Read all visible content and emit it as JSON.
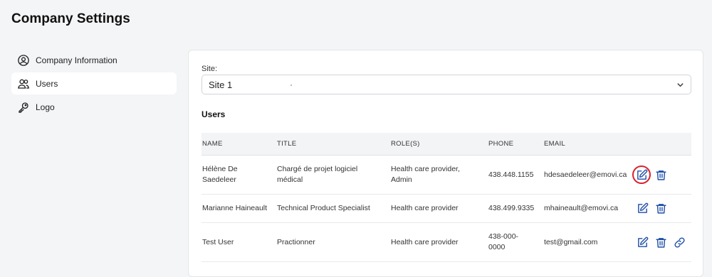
{
  "page": {
    "title": "Company Settings"
  },
  "sidebar": {
    "items": [
      {
        "label": "Company Information",
        "icon": "user-circle-icon",
        "active": false
      },
      {
        "label": "Users",
        "icon": "users-icon",
        "active": true
      },
      {
        "label": "Logo",
        "icon": "key-icon",
        "active": false
      }
    ]
  },
  "site": {
    "label": "Site:",
    "value": "Site 1"
  },
  "users": {
    "heading": "Users",
    "columns": [
      "NAME",
      "TITLE",
      "ROLE(S)",
      "PHONE",
      "EMAIL"
    ],
    "rows": [
      {
        "name": "Hélène De Saedeleer",
        "title": "Chargé de projet logiciel médical",
        "roles": "Health care provider, Admin",
        "phone": "438.448.1155",
        "email": "hdesaedeleer@emovi.ca"
      },
      {
        "name": "Marianne Haineault",
        "title": "Technical Product Specialist",
        "roles": "Health care provider",
        "phone": "438.499.9335",
        "email": "mhaineault@emovi.ca"
      },
      {
        "name": "Test User",
        "title": "Practionner",
        "roles": "Health care provider",
        "phone": "438-000-0000",
        "email": "test@gmail.com"
      }
    ]
  },
  "colors": {
    "accent": "#1f4fa8",
    "highlight_ring": "#d9232d"
  }
}
